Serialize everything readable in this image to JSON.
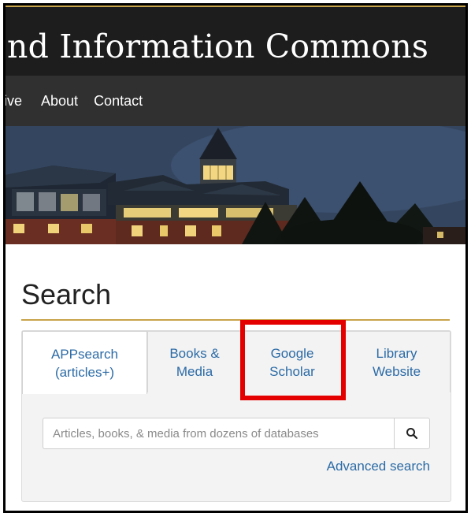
{
  "header": {
    "title": "nd Information Commons"
  },
  "nav": {
    "items": [
      "ive",
      "About",
      "Contact"
    ]
  },
  "search": {
    "heading": "Search",
    "tabs": [
      {
        "label": "APPsearch\n(articles+)",
        "active": true
      },
      {
        "label": "Books &\nMedia",
        "active": false
      },
      {
        "label": "Google\nScholar",
        "active": false
      },
      {
        "label": "Library\nWebsite",
        "active": false
      }
    ],
    "placeholder": "Articles, books, & media from dozens of databases",
    "button_icon": "search-icon",
    "advanced_label": "Advanced search"
  },
  "annotation": {
    "color": "#e50000"
  },
  "colors": {
    "link": "#2c6ba6",
    "accent_gold": "#c8a44a",
    "title_bar": "#1d1d1d",
    "nav_bar": "#303030"
  }
}
